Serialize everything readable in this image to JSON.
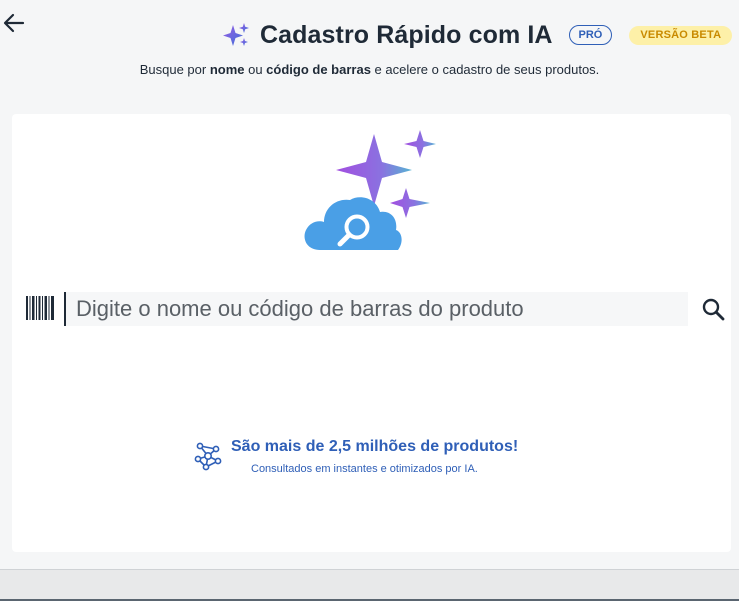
{
  "header": {
    "title": "Cadastro Rápido com IA",
    "badge_pro": "PRÓ",
    "badge_beta": "VERSÃO BETA",
    "subtitle": {
      "part1": "Busque por ",
      "bold1": "nome",
      "part2": " ou ",
      "bold2": "código de barras",
      "part3": " e acelere o cadastro de seus produtos."
    }
  },
  "search": {
    "placeholder": "Digite o nome ou código de barras do produto",
    "value": ""
  },
  "promo": {
    "title": "São mais de 2,5 milhões de produtos!",
    "subtitle": "Consultados em instantes e otimizados por IA."
  },
  "icons": [
    "back-arrow-icon",
    "sparkle-icon",
    "cloud-search-icon",
    "barcode-icon",
    "search-icon",
    "network-icon"
  ],
  "colors": {
    "primary_blue": "#2f5fb7",
    "beta_bg": "#fdf0a8",
    "beta_text": "#c98a00",
    "sparkle_purple": "#8a5cd6",
    "cloud_blue": "#4a9fe6"
  }
}
